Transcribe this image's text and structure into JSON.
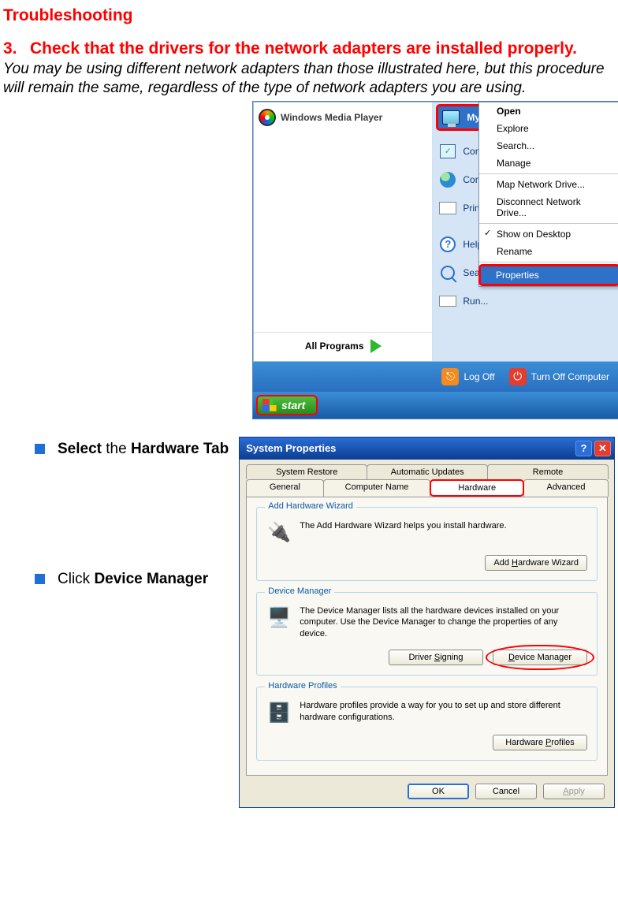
{
  "page": {
    "title": "Troubleshooting",
    "step_number": "3.",
    "step_text": "Check that the drivers for the network adapters are installed properly.",
    "intro": "You may be using different network adapters than those illustrated here, but this procedure will remain the same, regardless of the type of network adapters you are using."
  },
  "bullets": {
    "b1_prefix": "Select",
    "b1_rest": " the ",
    "b1_bold_rest": "Hardware Tab",
    "b2_prefix": "Click ",
    "b2_bold": "Device Manager"
  },
  "start_menu": {
    "wmp": "Windows Media Player",
    "right": {
      "mycomputer": "My Cor",
      "control_panel": "Control P",
      "connect": "Connect",
      "printers": "Printers a",
      "help": "Help and",
      "search": "Search",
      "run": "Run..."
    },
    "all_programs": "All Programs",
    "footer": {
      "logoff": "Log Off",
      "turnoff": "Turn Off Computer"
    },
    "start": "start"
  },
  "context_menu": {
    "open": "Open",
    "explore": "Explore",
    "search": "Search...",
    "manage": "Manage",
    "map": "Map Network Drive...",
    "disconnect": "Disconnect Network Drive...",
    "show_desktop": "Show on Desktop",
    "rename": "Rename",
    "properties": "Properties"
  },
  "sys_props": {
    "title": "System Properties",
    "tabs": {
      "system_restore": "System Restore",
      "automatic_updates": "Automatic Updates",
      "remote": "Remote",
      "general": "General",
      "computer_name": "Computer Name",
      "hardware": "Hardware",
      "advanced": "Advanced"
    },
    "add_hw": {
      "title": "Add Hardware Wizard",
      "text": "The Add Hardware Wizard helps you install hardware.",
      "button": "Add Hardware Wizard"
    },
    "dev_mgr": {
      "title": "Device Manager",
      "text": "The Device Manager lists all the hardware devices installed on your computer. Use the Device Manager to change the properties of any device.",
      "driver_signing": "Driver Signing",
      "device_manager": "Device Manager"
    },
    "hw_profiles": {
      "title": "Hardware Profiles",
      "text": "Hardware profiles provide a way for you to set up and store different hardware configurations.",
      "button": "Hardware Profiles"
    },
    "footer": {
      "ok": "OK",
      "cancel": "Cancel",
      "apply": "Apply"
    }
  }
}
